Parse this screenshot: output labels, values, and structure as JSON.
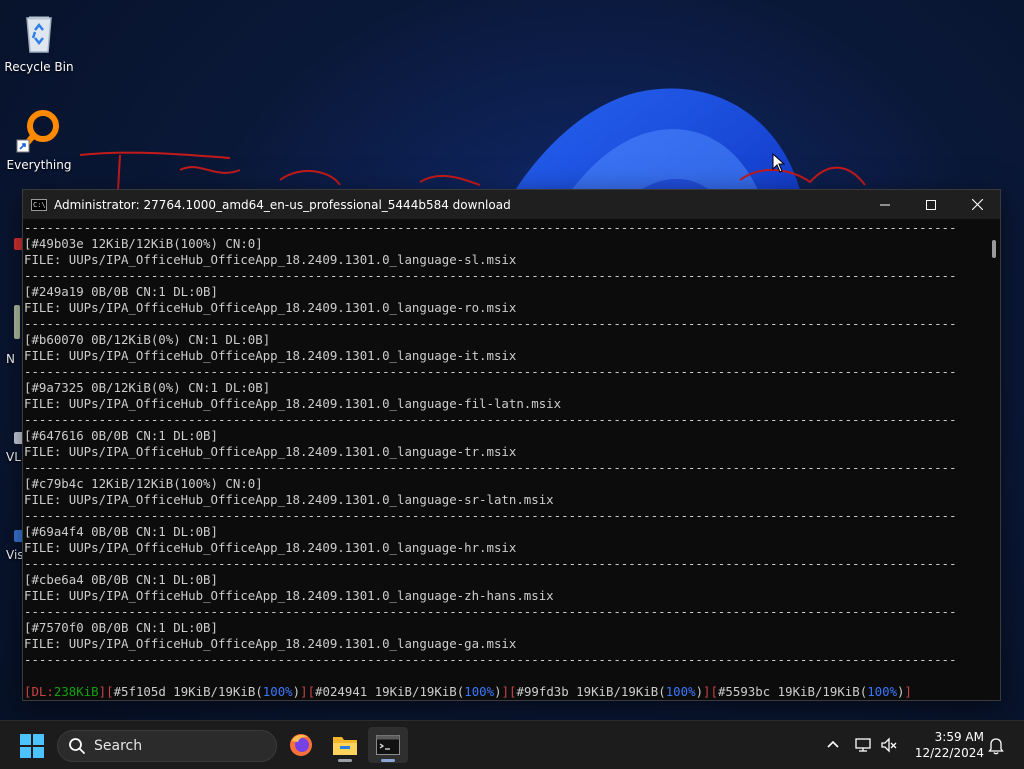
{
  "desktop": {
    "icons": [
      {
        "label": "Recycle Bin",
        "icon": "recycle-bin-icon"
      },
      {
        "label": "Everything",
        "icon": "everything-search-icon"
      }
    ],
    "partial_labels": [
      "N",
      "VL",
      "Vis"
    ]
  },
  "window": {
    "title": "Administrator:  27764.1000_amd64_en-us_professional_5444b584 download",
    "controls": [
      "minimize-icon",
      "maximize-icon",
      "close-icon"
    ],
    "separator": "-----------------------------------------------------------------------------------------------------------------------------",
    "entries": [
      {
        "status": "[#49b03e 12KiB/12KiB(100%) CN:0]",
        "file": "FILE: UUPs/IPA_OfficeHub_OfficeApp_18.2409.1301.0_language-sl.msix"
      },
      {
        "status": "[#249a19 0B/0B CN:1 DL:0B]",
        "file": "FILE: UUPs/IPA_OfficeHub_OfficeApp_18.2409.1301.0_language-ro.msix"
      },
      {
        "status": "[#b60070 0B/12KiB(0%) CN:1 DL:0B]",
        "file": "FILE: UUPs/IPA_OfficeHub_OfficeApp_18.2409.1301.0_language-it.msix"
      },
      {
        "status": "[#9a7325 0B/12KiB(0%) CN:1 DL:0B]",
        "file": "FILE: UUPs/IPA_OfficeHub_OfficeApp_18.2409.1301.0_language-fil-latn.msix"
      },
      {
        "status": "[#647616 0B/0B CN:1 DL:0B]",
        "file": "FILE: UUPs/IPA_OfficeHub_OfficeApp_18.2409.1301.0_language-tr.msix"
      },
      {
        "status": "[#c79b4c 12KiB/12KiB(100%) CN:0]",
        "file": "FILE: UUPs/IPA_OfficeHub_OfficeApp_18.2409.1301.0_language-sr-latn.msix"
      },
      {
        "status": "[#69a4f4 0B/0B CN:1 DL:0B]",
        "file": "FILE: UUPs/IPA_OfficeHub_OfficeApp_18.2409.1301.0_language-hr.msix"
      },
      {
        "status": "[#cbe6a4 0B/0B CN:1 DL:0B]",
        "file": "FILE: UUPs/IPA_OfficeHub_OfficeApp_18.2409.1301.0_language-zh-hans.msix"
      },
      {
        "status": "[#7570f0 0B/0B CN:1 DL:0B]",
        "file": "FILE: UUPs/IPA_OfficeHub_OfficeApp_18.2409.1301.0_language-ga.msix"
      }
    ],
    "summary": {
      "dl_prefix": "DL:",
      "dl_value": "238KiB",
      "items": [
        {
          "id": "#5f105d 19KiB/19KiB",
          "pct": "100%"
        },
        {
          "id": "#024941 19KiB/19KiB",
          "pct": "100%"
        },
        {
          "id": "#99fd3b 19KiB/19KiB",
          "pct": "100%"
        },
        {
          "id": "#5593bc 19KiB/19KiB",
          "pct": "100%"
        }
      ]
    }
  },
  "taskbar": {
    "search_label": "Search",
    "apps": [
      "firefox-icon",
      "file-explorer-icon",
      "terminal-icon"
    ],
    "active_app": "terminal-icon",
    "tray_icons": [
      "chevron-up-icon",
      "network-icon",
      "volume-muted-icon",
      "notification-bell-icon"
    ],
    "time": "3:59 AM",
    "date": "12/22/2024"
  },
  "colors": {
    "console_bg": "#0c0c0c",
    "console_text": "#cccccc",
    "status_red": "#c9424a",
    "status_green": "#13a10e",
    "status_blue": "#3b78ff"
  }
}
